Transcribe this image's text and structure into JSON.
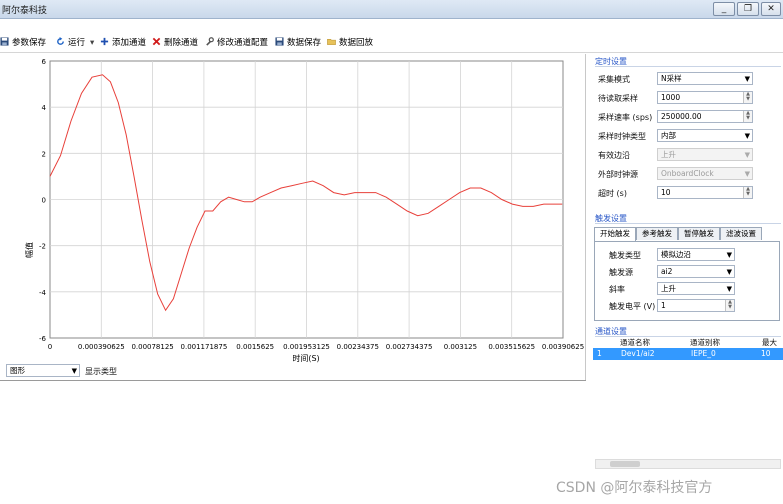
{
  "window": {
    "title": "阿尔泰科技",
    "buttons": {
      "minimize": "_",
      "restore": "❐",
      "close": "✕"
    }
  },
  "toolbar": {
    "params_save": "参数保存",
    "run": "运行",
    "run_dropdown": "▾",
    "add_channel": "添加通道",
    "delete_channel": "删除通道",
    "modify_channel_config": "修改通道配置",
    "data_save": "数据保存",
    "data_playback": "数据回放"
  },
  "display_type": {
    "selected": "图形",
    "label": "显示类型"
  },
  "timing": {
    "section_title": "定时设置",
    "rows": [
      {
        "label": "采集模式",
        "value": "N采样",
        "kind": "dropdown",
        "disabled": false
      },
      {
        "label": "待读取采样",
        "value": "1000",
        "kind": "spin",
        "disabled": false
      },
      {
        "label": "采样速率 (sps)",
        "value": "250000.00",
        "kind": "spin",
        "disabled": false
      },
      {
        "label": "采样时钟类型",
        "value": "内部",
        "kind": "dropdown",
        "disabled": false
      },
      {
        "label": "有效边沿",
        "value": "上升",
        "kind": "dropdown",
        "disabled": true
      },
      {
        "label": "外部时钟源",
        "value": "OnboardClock",
        "kind": "dropdown",
        "disabled": true
      },
      {
        "label": "超时 (s)",
        "value": "10",
        "kind": "spin",
        "disabled": false
      }
    ]
  },
  "trigger": {
    "section_title": "触发设置",
    "tabs": [
      "开始触发",
      "参考触发",
      "暂停触发",
      "滤波设置"
    ],
    "active_tab": 0,
    "rows": [
      {
        "label": "触发类型",
        "value": "模拟边沿",
        "kind": "dropdown"
      },
      {
        "label": "触发源",
        "value": "ai2",
        "kind": "dropdown"
      },
      {
        "label": "斜率",
        "value": "上升",
        "kind": "dropdown"
      },
      {
        "label": "触发电平 (V)",
        "value": "1",
        "kind": "spin"
      }
    ]
  },
  "channels": {
    "section_title": "通道设置",
    "headers": [
      "通道名称",
      "通道别称",
      "最大"
    ],
    "rows": [
      {
        "index": "1",
        "name": "Dev1/ai2",
        "alias": "IEPE_0",
        "max": "10"
      }
    ]
  },
  "watermark": "CSDN @阿尔泰科技官方",
  "chart_data": {
    "type": "line",
    "title": "",
    "xlabel": "时间(S)",
    "ylabel": "幅值",
    "xlim": [
      0,
      0.00390625
    ],
    "ylim": [
      -6,
      6
    ],
    "grid": true,
    "x_ticks": [
      "0",
      "0.000390625",
      "0.00078125",
      "0.001171875",
      "0.0015625",
      "0.001953125",
      "0.00234375",
      "0.002734375",
      "0.003125",
      "0.003515625",
      "0.00390625"
    ],
    "y_ticks": [
      "-6",
      "-4",
      "-2",
      "0",
      "2",
      "4",
      "6"
    ],
    "series": [
      {
        "color": "#e8403a",
        "x": [
          0,
          8e-05,
          0.00016,
          0.00024,
          0.00032,
          0.0004,
          0.00046,
          0.00052,
          0.00058,
          0.00064,
          0.0007,
          0.00076,
          0.00082,
          0.00088,
          0.00094,
          0.001,
          0.00106,
          0.00112,
          0.00118,
          0.00124,
          0.0013,
          0.00136,
          0.00142,
          0.00148,
          0.00154,
          0.0016,
          0.00168,
          0.00176,
          0.00184,
          0.00192,
          0.002,
          0.00208,
          0.00216,
          0.00224,
          0.00232,
          0.0024,
          0.00248,
          0.00256,
          0.00264,
          0.00272,
          0.0028,
          0.00288,
          0.00296,
          0.00304,
          0.00312,
          0.0032,
          0.00328,
          0.00336,
          0.00344,
          0.00352,
          0.0036,
          0.00368,
          0.00376,
          0.00384,
          0.0039
        ],
        "y": [
          1.0,
          1.9,
          3.4,
          4.6,
          5.3,
          5.4,
          5.1,
          4.2,
          2.8,
          1.0,
          -0.9,
          -2.7,
          -4.1,
          -4.8,
          -4.3,
          -3.2,
          -2.1,
          -1.2,
          -0.5,
          -0.5,
          -0.1,
          0.1,
          0.0,
          -0.1,
          -0.1,
          0.1,
          0.3,
          0.5,
          0.6,
          0.7,
          0.8,
          0.6,
          0.3,
          0.2,
          0.3,
          0.3,
          0.3,
          0.1,
          -0.2,
          -0.5,
          -0.7,
          -0.6,
          -0.3,
          0.0,
          0.3,
          0.5,
          0.5,
          0.3,
          0.0,
          -0.2,
          -0.3,
          -0.3,
          -0.2,
          -0.2,
          -0.2
        ]
      }
    ]
  }
}
